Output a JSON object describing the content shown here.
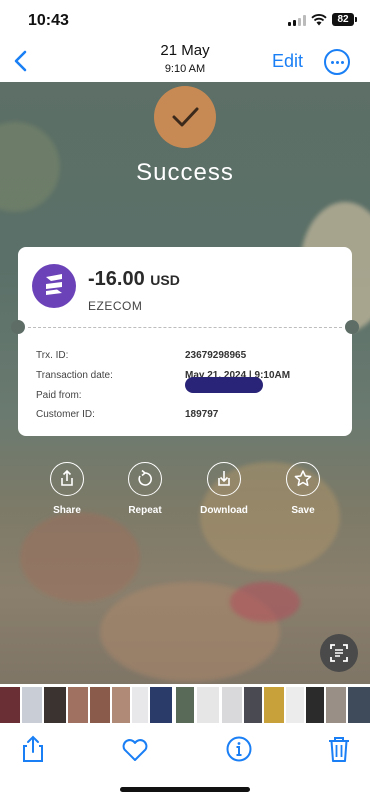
{
  "status_bar": {
    "time": "10:43",
    "battery": "82"
  },
  "header": {
    "date": "21 May",
    "time": "9:10 AM",
    "edit_label": "Edit"
  },
  "receipt": {
    "status": "Success",
    "amount": "-16.00",
    "currency": "USD",
    "merchant": "EZECOM",
    "rows": [
      {
        "label": "Trx. ID:",
        "value": "23679298965"
      },
      {
        "label": "Transaction date:",
        "value": "May 21, 2024 | 9:10AM"
      },
      {
        "label": "Paid from:",
        "value": ""
      },
      {
        "label": "Customer ID:",
        "value": "189797"
      }
    ]
  },
  "actions": [
    {
      "label": "Share",
      "icon": "share-icon"
    },
    {
      "label": "Repeat",
      "icon": "repeat-icon"
    },
    {
      "label": "Download",
      "icon": "download-icon"
    },
    {
      "label": "Save",
      "icon": "star-icon"
    }
  ],
  "toolbar": [
    "share-icon",
    "heart-icon",
    "info-icon",
    "trash-icon"
  ],
  "colors": {
    "accent": "#1a7ff5",
    "card_brand": "#6b42b8",
    "success_badge": "#c88a54"
  }
}
